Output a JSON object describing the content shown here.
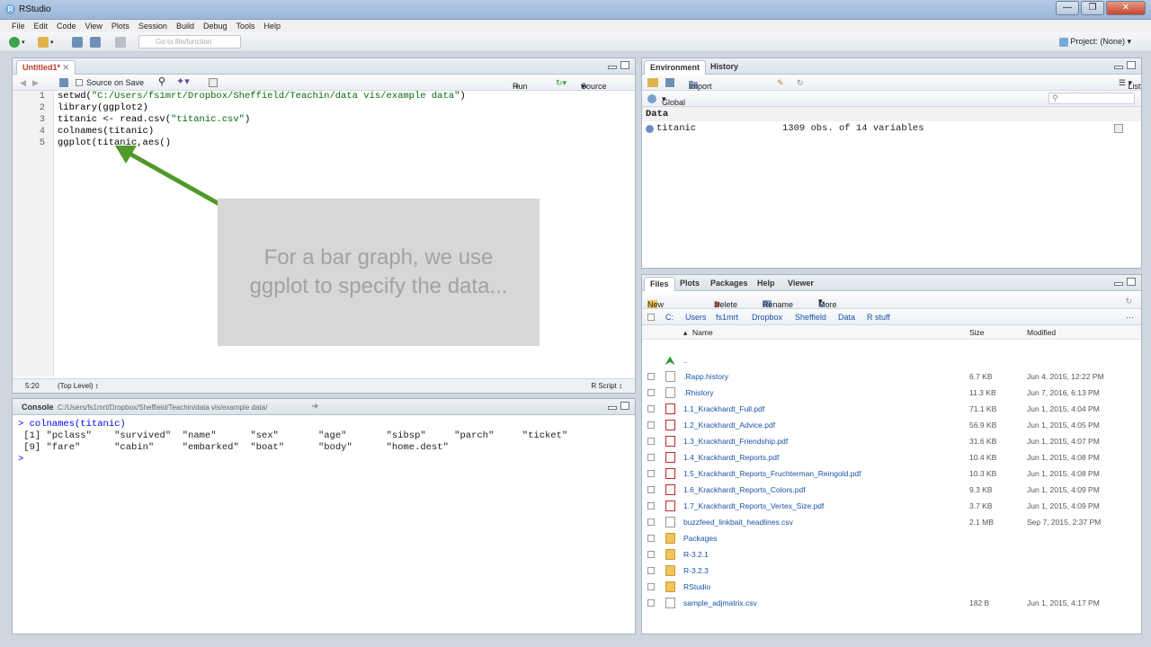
{
  "window": {
    "title": "RStudio"
  },
  "menu": [
    "File",
    "Edit",
    "Code",
    "View",
    "Plots",
    "Session",
    "Build",
    "Debug",
    "Tools",
    "Help"
  ],
  "toolbar": {
    "goto_placeholder": "Go to file/function",
    "project": "Project: (None)"
  },
  "editor": {
    "tab": "Untitled1*",
    "source_on_save": "Source on Save",
    "run": "Run",
    "source": "Source",
    "lines": [
      {
        "n": "1",
        "pre": "setwd(",
        "str": "\"C:/Users/fs1mrt/Dropbox/Sheffield/Teachin/data vis/example data\"",
        "post": ")"
      },
      {
        "n": "2",
        "pre": "library(ggplot2)",
        "str": "",
        "post": ""
      },
      {
        "n": "3",
        "pre": "titanic <- read.csv(",
        "str": "\"titanic.csv\"",
        "post": ")"
      },
      {
        "n": "4",
        "pre": "colnames(titanic)",
        "str": "",
        "post": ""
      },
      {
        "n": "5",
        "pre": "ggplot(titanic,aes()",
        "str": "",
        "post": ""
      }
    ],
    "status_pos": "5:20",
    "status_level": "(Top Level) ↕",
    "status_type": "R Script ↕"
  },
  "overlay_text": "For a bar graph, we use ggplot to specify the data...",
  "console": {
    "tab": "Console",
    "path": "C:/Users/fs1mrt/Dropbox/Sheffield/Teachin/data vis/example data/",
    "lines": [
      "> colnames(titanic)",
      " [1] \"pclass\"    \"survived\"  \"name\"      \"sex\"       \"age\"       \"sibsp\"     \"parch\"     \"ticket\"",
      " [9] \"fare\"      \"cabin\"     \"embarked\"  \"boat\"      \"body\"      \"home.dest\"",
      "> "
    ]
  },
  "environment": {
    "tabs": [
      "Environment",
      "History"
    ],
    "import": "Import Dataset",
    "list": "List",
    "global": "Global Environment",
    "section": "Data",
    "rows": [
      {
        "name": "titanic",
        "value": "1309 obs. of 14 variables"
      }
    ]
  },
  "files": {
    "tabs": [
      "Files",
      "Plots",
      "Packages",
      "Help",
      "Viewer"
    ],
    "actions": [
      "New Folder",
      "Delete",
      "Rename",
      "More"
    ],
    "breadcrumb": [
      "C:",
      "Users",
      "fs1mrt",
      "Dropbox",
      "Sheffield",
      "Data",
      "R stuff"
    ],
    "headers": {
      "name": "Name",
      "size": "Size",
      "modified": "Modified"
    },
    "rows": [
      {
        "type": "up",
        "name": "..",
        "size": "",
        "modified": ""
      },
      {
        "type": "doc",
        "name": ".Rapp.history",
        "size": "6.7 KB",
        "modified": "Jun 4, 2015, 12:22 PM"
      },
      {
        "type": "doc",
        "name": ".Rhistory",
        "size": "11.3 KB",
        "modified": "Jun 7, 2016, 6:13 PM"
      },
      {
        "type": "pdf",
        "name": "1.1_Krackhardt_Full.pdf",
        "size": "71.1 KB",
        "modified": "Jun 1, 2015, 4:04 PM"
      },
      {
        "type": "pdf",
        "name": "1.2_Krackhardt_Advice.pdf",
        "size": "56.9 KB",
        "modified": "Jun 1, 2015, 4:05 PM"
      },
      {
        "type": "pdf",
        "name": "1.3_Krackhardt_Friendship.pdf",
        "size": "31.6 KB",
        "modified": "Jun 1, 2015, 4:07 PM"
      },
      {
        "type": "pdf",
        "name": "1.4_Krackhardt_Reports.pdf",
        "size": "10.4 KB",
        "modified": "Jun 1, 2015, 4:08 PM"
      },
      {
        "type": "pdf",
        "name": "1.5_Krackhardt_Reports_Fruchterman_Reingold.pdf",
        "size": "10.3 KB",
        "modified": "Jun 1, 2015, 4:08 PM"
      },
      {
        "type": "pdf",
        "name": "1.6_Krackhardt_Reports_Colors.pdf",
        "size": "9.3 KB",
        "modified": "Jun 1, 2015, 4:09 PM"
      },
      {
        "type": "pdf",
        "name": "1.7_Krackhardt_Reports_Vertex_Size.pdf",
        "size": "3.7 KB",
        "modified": "Jun 1, 2015, 4:09 PM"
      },
      {
        "type": "doc",
        "name": "buzzfeed_linkbait_headlines.csv",
        "size": "2.1 MB",
        "modified": "Sep 7, 2015, 2:37 PM"
      },
      {
        "type": "folder",
        "name": "Packages",
        "size": "",
        "modified": ""
      },
      {
        "type": "folder",
        "name": "R-3.2.1",
        "size": "",
        "modified": ""
      },
      {
        "type": "folder",
        "name": "R-3.2.3",
        "size": "",
        "modified": ""
      },
      {
        "type": "folder",
        "name": "RStudio",
        "size": "",
        "modified": ""
      },
      {
        "type": "doc",
        "name": "sample_adjmatrix.csv",
        "size": "182 B",
        "modified": "Jun 1, 2015, 4:17 PM"
      }
    ]
  }
}
